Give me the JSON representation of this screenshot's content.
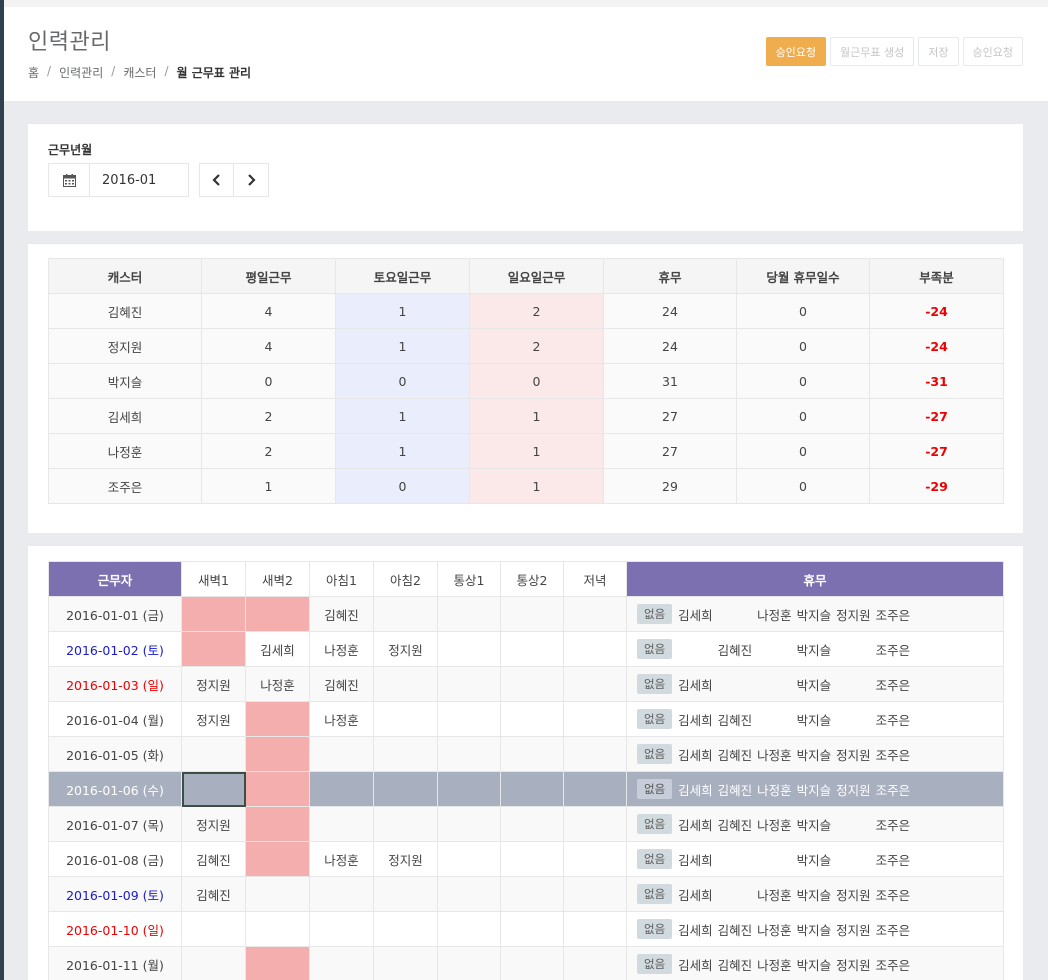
{
  "header": {
    "title": "인력관리",
    "breadcrumb": [
      "홈",
      "인력관리",
      "캐스터",
      "월 근무표 관리"
    ],
    "buttons": [
      "승인요청",
      "월근무표 생성",
      "저장",
      "승인요청"
    ]
  },
  "filter": {
    "label": "근무년월",
    "month_value": "2016-01"
  },
  "summary": {
    "headers": [
      "캐스터",
      "평일근무",
      "토요일근무",
      "일요일근무",
      "휴무",
      "당월 휴무일수",
      "부족분"
    ],
    "rows": [
      [
        "김혜진",
        "4",
        "1",
        "2",
        "24",
        "0",
        "-24"
      ],
      [
        "정지원",
        "4",
        "1",
        "2",
        "24",
        "0",
        "-24"
      ],
      [
        "박지슬",
        "0",
        "0",
        "0",
        "31",
        "0",
        "-31"
      ],
      [
        "김세희",
        "2",
        "1",
        "1",
        "27",
        "0",
        "-27"
      ],
      [
        "나정훈",
        "2",
        "1",
        "1",
        "27",
        "0",
        "-27"
      ],
      [
        "조주은",
        "1",
        "0",
        "1",
        "29",
        "0",
        "-29"
      ]
    ]
  },
  "schedule": {
    "headers": [
      "근무자",
      "새벽1",
      "새벽2",
      "아침1",
      "아침2",
      "통상1",
      "통상2",
      "저녁",
      "휴무"
    ],
    "rest_badge": "없음",
    "rows": [
      {
        "date": "2016-01-01 (금)",
        "cells": [
          "",
          "",
          "김혜진",
          "",
          "",
          "",
          ""
        ],
        "rest": [
          "김세희",
          "",
          "나정훈",
          "박지슬",
          "정지원",
          "조주은"
        ]
      },
      {
        "date": "2016-01-02 (토)",
        "cells": [
          "",
          "김세희",
          "나정훈",
          "정지원",
          "",
          "",
          ""
        ],
        "rest": [
          "",
          "김혜진",
          "",
          "박지슬",
          "",
          "조주은"
        ]
      },
      {
        "date": "2016-01-03 (일)",
        "cells": [
          "정지원",
          "나정훈",
          "김혜진",
          "",
          "",
          "",
          ""
        ],
        "rest": [
          "김세희",
          "",
          "",
          "박지슬",
          "",
          "조주은"
        ]
      },
      {
        "date": "2016-01-04 (월)",
        "cells": [
          "정지원",
          "",
          "나정훈",
          "",
          "",
          "",
          ""
        ],
        "rest": [
          "김세희",
          "김혜진",
          "",
          "박지슬",
          "",
          "조주은"
        ]
      },
      {
        "date": "2016-01-05 (화)",
        "cells": [
          "",
          "",
          "",
          "",
          "",
          "",
          ""
        ],
        "rest": [
          "김세희",
          "김혜진",
          "나정훈",
          "박지슬",
          "정지원",
          "조주은"
        ]
      },
      {
        "date": "2016-01-06 (수)",
        "cells": [
          "",
          "",
          "",
          "",
          "",
          "",
          ""
        ],
        "rest": [
          "김세희",
          "김혜진",
          "나정훈",
          "박지슬",
          "정지원",
          "조주은"
        ]
      },
      {
        "date": "2016-01-07 (목)",
        "cells": [
          "정지원",
          "",
          "",
          "",
          "",
          "",
          ""
        ],
        "rest": [
          "김세희",
          "김혜진",
          "나정훈",
          "박지슬",
          "",
          "조주은"
        ]
      },
      {
        "date": "2016-01-08 (금)",
        "cells": [
          "김혜진",
          "",
          "나정훈",
          "정지원",
          "",
          "",
          ""
        ],
        "rest": [
          "김세희",
          "",
          "",
          "박지슬",
          "",
          "조주은"
        ]
      },
      {
        "date": "2016-01-09 (토)",
        "cells": [
          "김혜진",
          "",
          "",
          "",
          "",
          "",
          ""
        ],
        "rest": [
          "김세희",
          "",
          "나정훈",
          "박지슬",
          "정지원",
          "조주은"
        ]
      },
      {
        "date": "2016-01-10 (일)",
        "cells": [
          "",
          "",
          "",
          "",
          "",
          "",
          ""
        ],
        "rest": [
          "김세희",
          "김혜진",
          "나정훈",
          "박지슬",
          "정지원",
          "조주은"
        ]
      },
      {
        "date": "2016-01-11 (월)",
        "cells": [
          "",
          "",
          "",
          "",
          "",
          "",
          ""
        ],
        "rest": [
          "김세희",
          "김혜진",
          "나정훈",
          "박지슬",
          "정지원",
          "조주은"
        ]
      }
    ]
  },
  "colors": {
    "accent_warning": "#f0ad4e",
    "header_purple": "#7d70b1",
    "empty_slot_pink": "#f4aeae",
    "saturday_blue": "#1a1acc",
    "sunday_red": "#e00000",
    "selected_row": "#a8afbf"
  }
}
